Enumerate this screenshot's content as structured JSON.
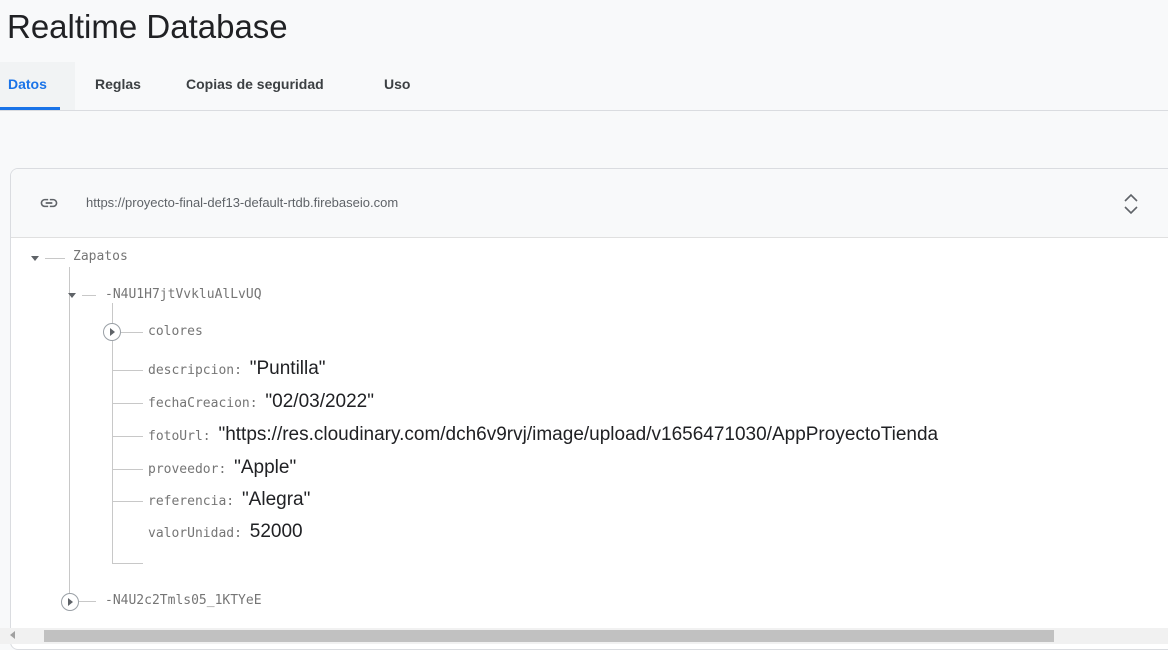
{
  "page": {
    "title": "Realtime Database"
  },
  "tabs": [
    {
      "label": "Datos",
      "active": true
    },
    {
      "label": "Reglas",
      "active": false
    },
    {
      "label": "Copias de seguridad",
      "active": false
    },
    {
      "label": "Uso",
      "active": false
    }
  ],
  "db": {
    "url": "https://proyecto-final-def13-default-rtdb.firebaseio.com",
    "link_icon": "link-icon",
    "expand_icon": "unfold-more-icon"
  },
  "tree": {
    "root_key": "Zapatos",
    "child1_key": "-N4U1H7jtVvkluAlLvUQ",
    "colores_key": "colores",
    "fields": [
      {
        "key": "descripcion",
        "sep": ": ",
        "value": "\"Puntilla\""
      },
      {
        "key": "fechaCreacion",
        "sep": ": ",
        "value": "\"02/03/2022\""
      },
      {
        "key": "fotoUrl",
        "sep": ": ",
        "value": "\"https://res.cloudinary.com/dch6v9rvj/image/upload/v1656471030/AppProyectoTienda"
      },
      {
        "key": "proveedor",
        "sep": ": ",
        "value": "\"Apple\""
      },
      {
        "key": "referencia",
        "sep": ": ",
        "value": "\"Alegra\""
      },
      {
        "key": "valorUnidad",
        "sep": ": ",
        "value": "52000"
      }
    ],
    "child2_key": "-N4U2c2Tmls05_1KTYeE"
  },
  "colors": {
    "accent": "#1a73e8",
    "text": "#202124",
    "muted": "#757575"
  }
}
